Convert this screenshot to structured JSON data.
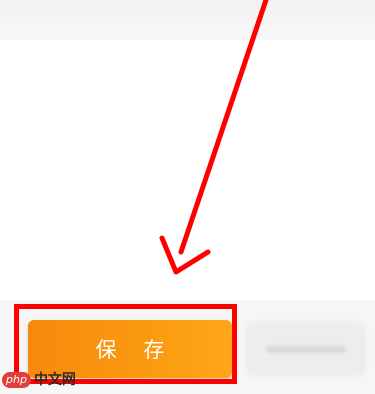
{
  "footer": {
    "save_label": "保 存"
  },
  "watermark": {
    "php": "php",
    "site": "中文网"
  },
  "colors": {
    "save_button": "#fb9a10",
    "annotation": "#ff0000",
    "background": "#ffffff"
  }
}
